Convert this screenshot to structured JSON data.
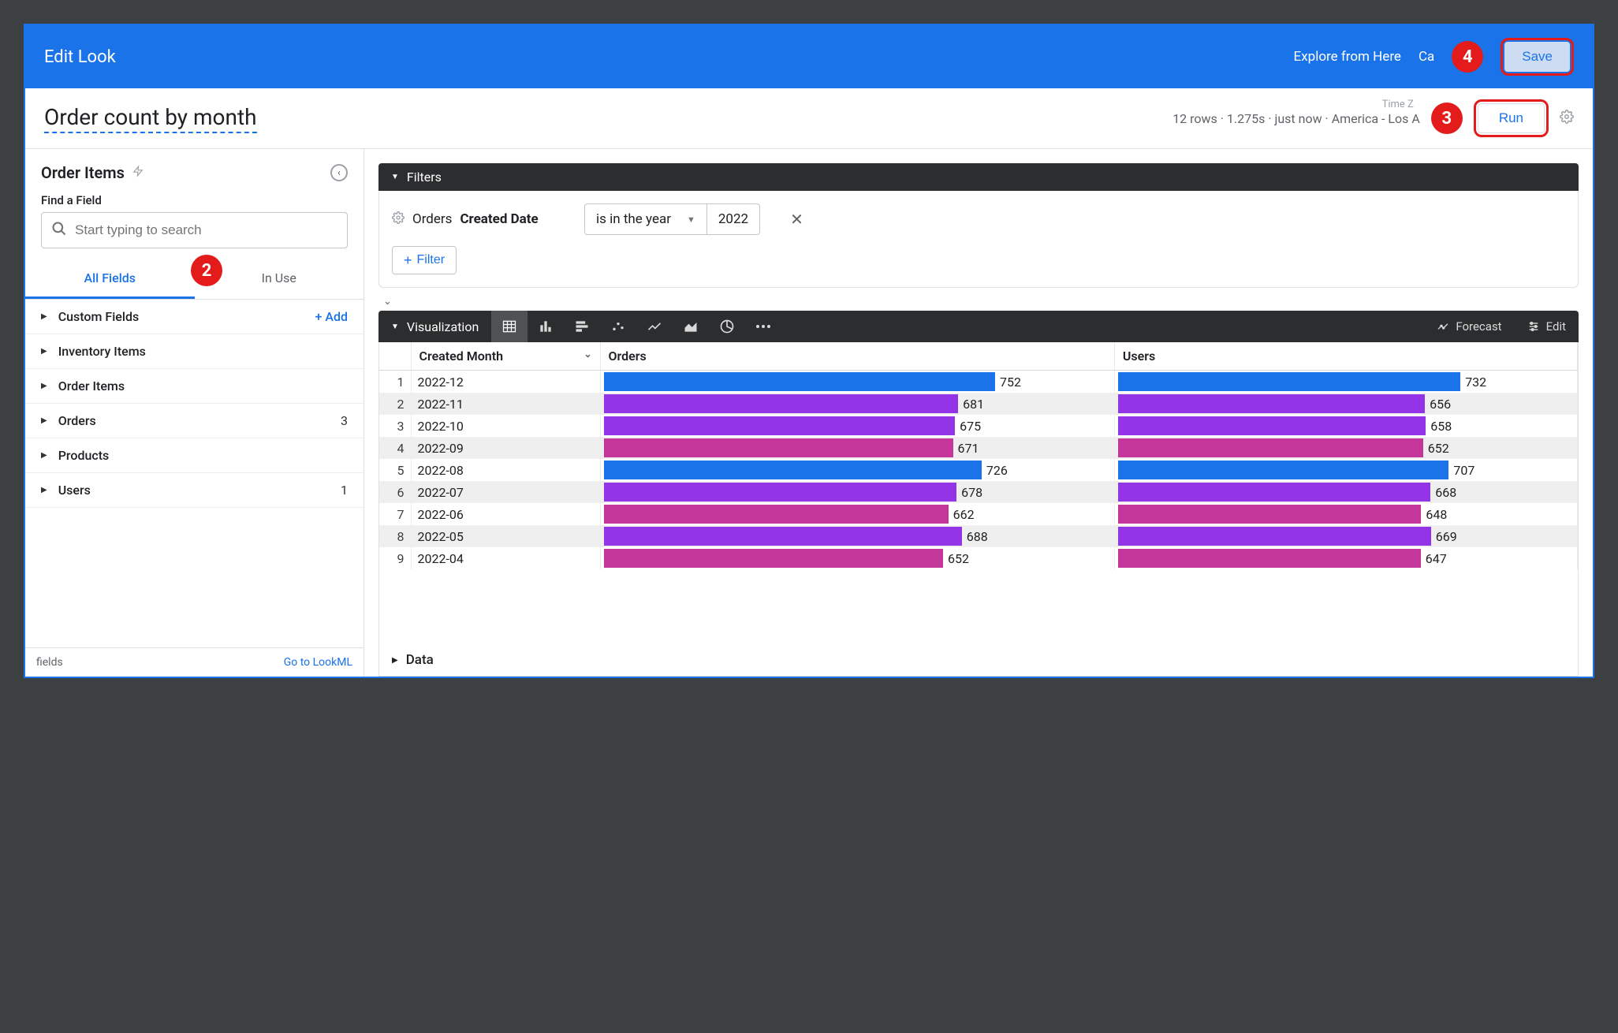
{
  "header": {
    "title": "Edit Look",
    "explore_link": "Explore from Here",
    "cancel_label": "Ca",
    "save_label": "Save"
  },
  "look": {
    "title": "Order count by month",
    "tz_label": "Time Z",
    "status_text": "12 rows · 1.275s · just now · America - Los A",
    "run_label": "Run"
  },
  "sidebar": {
    "title": "Order Items",
    "find_label": "Find a Field",
    "search_placeholder": "Start typing to search",
    "tabs": {
      "all": "All Fields",
      "inuse": "In Use"
    },
    "add_label": "+  Add",
    "fields": [
      {
        "label": "Custom Fields",
        "extra": "add"
      },
      {
        "label": "Inventory Items"
      },
      {
        "label": "Order Items"
      },
      {
        "label": "Orders",
        "count": "3"
      },
      {
        "label": "Products"
      },
      {
        "label": "Users",
        "count": "1"
      }
    ],
    "foot_left": "fields",
    "foot_right": "Go to LookML"
  },
  "filters": {
    "header": "Filters",
    "label_prefix": "Orders",
    "label_bold": "Created Date",
    "operator": "is in the year",
    "value": "2022",
    "add_btn": "Filter"
  },
  "viz": {
    "header": "Visualization",
    "forecast": "Forecast",
    "edit": "Edit",
    "columns": {
      "created": "Created Month",
      "orders": "Orders",
      "users": "Users"
    }
  },
  "data_section": {
    "header": "Data"
  },
  "annotations": {
    "a2": "2",
    "a3": "3",
    "a4": "4"
  },
  "chart_data": {
    "type": "table",
    "columns": [
      "row",
      "Created Month",
      "Orders",
      "Users"
    ],
    "max": 760,
    "rows": [
      {
        "n": 1,
        "month": "2022-12",
        "orders": 752,
        "users": 732,
        "color": "blue"
      },
      {
        "n": 2,
        "month": "2022-11",
        "orders": 681,
        "users": 656,
        "color": "purple"
      },
      {
        "n": 3,
        "month": "2022-10",
        "orders": 675,
        "users": 658,
        "color": "purple"
      },
      {
        "n": 4,
        "month": "2022-09",
        "orders": 671,
        "users": 652,
        "color": "magenta"
      },
      {
        "n": 5,
        "month": "2022-08",
        "orders": 726,
        "users": 707,
        "color": "blue"
      },
      {
        "n": 6,
        "month": "2022-07",
        "orders": 678,
        "users": 668,
        "color": "purple"
      },
      {
        "n": 7,
        "month": "2022-06",
        "orders": 662,
        "users": 648,
        "color": "magenta"
      },
      {
        "n": 8,
        "month": "2022-05",
        "orders": 688,
        "users": 669,
        "color": "purple"
      },
      {
        "n": 9,
        "month": "2022-04",
        "orders": 652,
        "users": 647,
        "color": "magenta"
      }
    ]
  }
}
